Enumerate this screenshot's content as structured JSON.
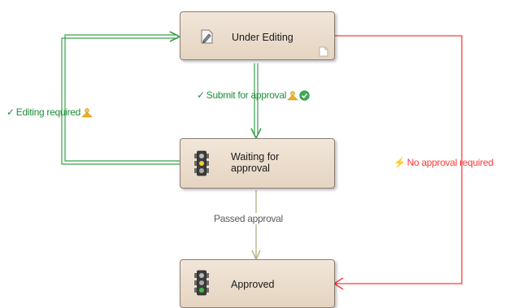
{
  "states": {
    "editing": {
      "label": "Under Editing"
    },
    "waiting": {
      "label": "Waiting for approval",
      "line1": "Waiting for",
      "line2": "approval"
    },
    "approved": {
      "label": "Approved"
    }
  },
  "transitions": {
    "submit": {
      "label": "Submit for approval",
      "mark": "✓"
    },
    "editing_required": {
      "label": "Editing required",
      "mark": "✓"
    },
    "passed": {
      "label": "Passed approval"
    },
    "no_approval": {
      "label": "No approval required",
      "mark": "⚡"
    }
  },
  "colors": {
    "green": "#3aa04c",
    "red": "#ff3a3a",
    "olive": "#b4ad86",
    "state_fill": "#e8d9c7",
    "state_border": "#8c7f72"
  },
  "icons": {
    "editing": "document-edit-icon",
    "editing_corner": "page-corner-icon",
    "waiting": "traffic-light-icon",
    "approved": "traffic-light-icon",
    "warning": "warning-person-icon",
    "accept": "green-check-circle-icon"
  }
}
